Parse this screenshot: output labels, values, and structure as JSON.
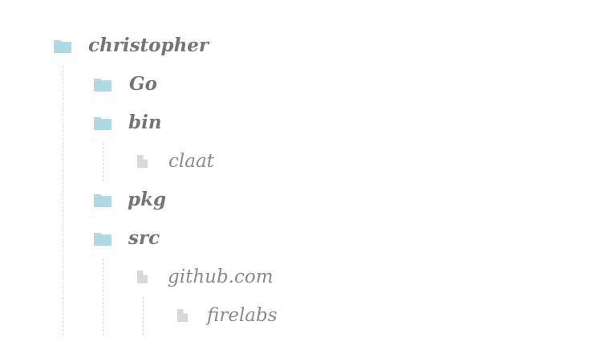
{
  "tree": {
    "root": {
      "label": "christopher",
      "icon": "folder-icon"
    },
    "go": {
      "label": "Go",
      "icon": "folder-icon"
    },
    "bin": {
      "label": "bin",
      "icon": "folder-icon"
    },
    "claat": {
      "label": "claat",
      "icon": "file-icon"
    },
    "pkg": {
      "label": "pkg",
      "icon": "folder-icon"
    },
    "src": {
      "label": "src",
      "icon": "folder-icon"
    },
    "github": {
      "label": "github.com",
      "icon": "file-icon"
    },
    "firelabs": {
      "label": "firelabs",
      "icon": "file-icon"
    }
  },
  "colors": {
    "folder_icon": "#b3dbe6",
    "file_icon": "#d9d9d9",
    "folder_text": "#757575",
    "file_text": "#8a8a8a",
    "guide_line": "#d6d6d6"
  }
}
